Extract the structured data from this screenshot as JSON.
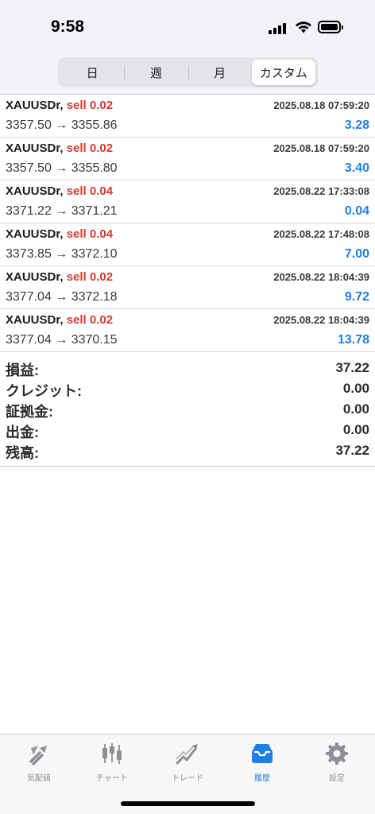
{
  "status": {
    "time": "9:58"
  },
  "segments": [
    {
      "label": "日",
      "active": false
    },
    {
      "label": "週",
      "active": false
    },
    {
      "label": "月",
      "active": false
    },
    {
      "label": "カスタム",
      "active": true
    }
  ],
  "trades": [
    {
      "symbol": "XAUUSDr,",
      "side": "sell 0.02",
      "datetime": "2025.08.18 07:59:20",
      "prices": "3357.50 → 3355.86",
      "profit": "3.28"
    },
    {
      "symbol": "XAUUSDr,",
      "side": "sell 0.02",
      "datetime": "2025.08.18 07:59:20",
      "prices": "3357.50 → 3355.80",
      "profit": "3.40"
    },
    {
      "symbol": "XAUUSDr,",
      "side": "sell 0.04",
      "datetime": "2025.08.22 17:33:08",
      "prices": "3371.22 → 3371.21",
      "profit": "0.04"
    },
    {
      "symbol": "XAUUSDr,",
      "side": "sell 0.04",
      "datetime": "2025.08.22 17:48:08",
      "prices": "3373.85 → 3372.10",
      "profit": "7.00"
    },
    {
      "symbol": "XAUUSDr,",
      "side": "sell 0.02",
      "datetime": "2025.08.22 18:04:39",
      "prices": "3377.04 → 3372.18",
      "profit": "9.72"
    },
    {
      "symbol": "XAUUSDr,",
      "side": "sell 0.02",
      "datetime": "2025.08.22 18:04:39",
      "prices": "3377.04 → 3370.15",
      "profit": "13.78"
    }
  ],
  "summary": [
    {
      "label": "損益:",
      "value": "37.22"
    },
    {
      "label": "クレジット:",
      "value": "0.00"
    },
    {
      "label": "証拠金:",
      "value": "0.00"
    },
    {
      "label": "出金:",
      "value": "0.00"
    },
    {
      "label": "残高:",
      "value": "37.22"
    }
  ],
  "tabbar": [
    {
      "label": "気配値",
      "icon": "quotes-icon",
      "active": false
    },
    {
      "label": "チャート",
      "icon": "chart-icon",
      "active": false
    },
    {
      "label": "トレード",
      "icon": "trade-icon",
      "active": false
    },
    {
      "label": "履歴",
      "icon": "history-icon",
      "active": true
    },
    {
      "label": "設定",
      "icon": "settings-icon",
      "active": false
    }
  ],
  "colors": {
    "accent": "#1f7fe6",
    "sell": "#d93a2f",
    "inactive_icon": "#8e8e93"
  }
}
